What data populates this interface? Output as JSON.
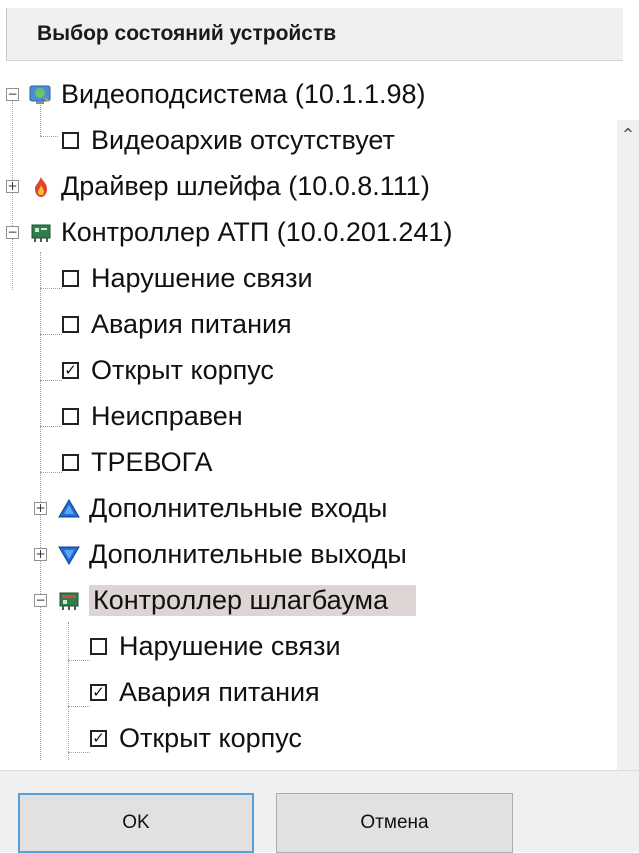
{
  "header": {
    "title": "Выбор состояний устройств"
  },
  "tree": [
    {
      "label": "Видеоподсистема (10.1.1.98)",
      "type": "node",
      "icon": "monitor-globe-icon",
      "expanded": true
    },
    {
      "label": "Видеоархив отсутствует",
      "type": "check",
      "checked": false
    },
    {
      "label": "Драйвер шлейфа (10.0.8.111)",
      "type": "node",
      "icon": "fire-driver-icon",
      "expanded": false
    },
    {
      "label": "Контроллер АТП (10.0.201.241)",
      "type": "node",
      "icon": "controller-board-icon",
      "expanded": true
    },
    {
      "label": "Нарушение связи",
      "type": "check",
      "checked": false
    },
    {
      "label": "Авария питания",
      "type": "check",
      "checked": false
    },
    {
      "label": "Открыт корпус",
      "type": "check",
      "checked": true
    },
    {
      "label": "Неисправен",
      "type": "check",
      "checked": false
    },
    {
      "label": "ТРЕВОГА",
      "type": "check",
      "checked": false
    },
    {
      "label": "Дополнительные входы",
      "type": "node",
      "icon": "blue-triangle-up-icon",
      "expanded": false
    },
    {
      "label": "Дополнительные выходы",
      "type": "node",
      "icon": "blue-triangle-down-icon",
      "expanded": false
    },
    {
      "label": "Контроллер шлагбаума",
      "type": "node",
      "icon": "barrier-controller-icon",
      "expanded": true,
      "selected": true
    },
    {
      "label": "Нарушение связи",
      "type": "check",
      "checked": false
    },
    {
      "label": "Авария питания",
      "type": "check",
      "checked": true
    },
    {
      "label": "Открыт корпус",
      "type": "check",
      "checked": true
    }
  ],
  "buttons": {
    "ok": "OK",
    "cancel": "Отмена"
  },
  "colors": {
    "selection": "#ddd5d4",
    "ok_border": "#5a9fd8",
    "triangle": "#1e6fd9"
  }
}
